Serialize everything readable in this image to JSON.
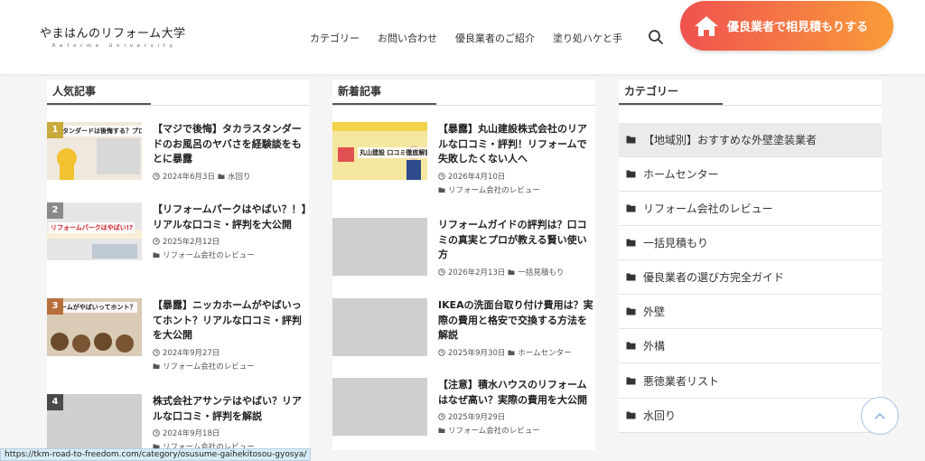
{
  "header": {
    "logo_main": "やまはんのリフォーム大学",
    "logo_sub": "Reforme University",
    "nav": [
      "カテゴリー",
      "お問い合わせ",
      "優良業者のご紹介",
      "塗り処ハケと手"
    ],
    "cta_label": "優良業者で相見積もりする"
  },
  "popular": {
    "title": "人気記事",
    "items": [
      {
        "rank": "1",
        "title": "【マジで後悔】タカラスタンダードのお風呂のヤバさを経験談をもとに暴露",
        "date": "2024年6月3日",
        "category": "水回り",
        "thumb_text": "スタンダードは後悔する？プロが解説"
      },
      {
        "rank": "2",
        "title": "【リフォームパークはやばい？！】リアルな口コミ・評判を大公開",
        "date": "2025年2月12日",
        "category": "リフォーム会社のレビュー",
        "thumb_text": "リフォームパークはやばい!?"
      },
      {
        "rank": "3",
        "title": "【暴露】ニッカホームがやばいってホント？リアルな口コミ・評判を大公開",
        "date": "2024年9月27日",
        "category": "リフォーム会社のレビュー",
        "thumb_text": "ホームがやばいってホント？"
      },
      {
        "rank": "4",
        "title": "株式会社アサンテはやばい？リアルな口コミ・評判を解説",
        "date": "2024年9月18日",
        "category": "リフォーム会社のレビュー",
        "thumb_text": ""
      }
    ]
  },
  "latest": {
    "title": "新着記事",
    "items": [
      {
        "title": "【暴露】丸山建設株式会社のリアルな口コミ・評判！リフォームで失敗したくない人へ",
        "date": "2026年4月10日",
        "category": "リフォーム会社のレビュー",
        "thumb_text": "丸山建設 口コミ徹底解説！"
      },
      {
        "title": "リフォームガイドの評判は？口コミの真実とプロが教える賢い使い方",
        "date": "2026年2月13日",
        "category": "一括見積もり",
        "thumb_text": ""
      },
      {
        "title": "IKEAの洗面台取り付け費用は？実際の費用と格安で交換する方法を解説",
        "date": "2025年9月30日",
        "category": "ホームセンター",
        "thumb_text": ""
      },
      {
        "title": "【注意】積水ハウスのリフォームはなぜ高い？実際の費用を大公開",
        "date": "2025年9月29日",
        "category": "リフォーム会社のレビュー",
        "thumb_text": ""
      }
    ]
  },
  "categories": {
    "title": "カテゴリー",
    "items": [
      "【地域別】おすすめな外壁塗装業者",
      "ホームセンター",
      "リフォーム会社のレビュー",
      "一括見積もり",
      "優良業者の選び方完全ガイド",
      "外壁",
      "外構",
      "悪徳業者リスト",
      "水回り"
    ]
  },
  "status_url": "https://tkm-road-to-freedom.com/category/osusume-gaihekitosou-gyosya/",
  "colors": {
    "cta_start": "#f0524f",
    "cta_end": "#f99c3a",
    "accent_line": "#555555"
  }
}
